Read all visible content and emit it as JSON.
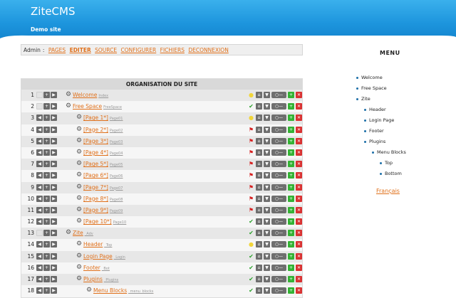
{
  "header": {
    "title": "ZiteCMS",
    "subtitle": "Demo site"
  },
  "adminbar": {
    "user": "Admin",
    "separator": ":",
    "links": [
      "PAGES",
      "EDITER",
      "SOURCE",
      "CONFIGURER",
      "FICHIERS",
      "DECONNEXION"
    ]
  },
  "panel": {
    "title": "ORGANISATION DU SITE",
    "rows": [
      {
        "num": "1",
        "label": "Welcome",
        "id": "Index",
        "level": 0,
        "status": "bulb",
        "ghost_first": true
      },
      {
        "num": "2",
        "label": "Free Space",
        "id": "FreeSpace",
        "level": 0,
        "status": "check",
        "ghost_first": true
      },
      {
        "num": "3",
        "label": "[Page 1*]",
        "id": "Page01",
        "level": 1,
        "status": "bulb",
        "ghost_first": false
      },
      {
        "num": "4",
        "label": "[Page 2*]",
        "id": "Page02",
        "level": 1,
        "status": "flag",
        "ghost_first": false
      },
      {
        "num": "5",
        "label": "[Page 3*]",
        "id": "Page03",
        "level": 1,
        "status": "flag",
        "ghost_first": false
      },
      {
        "num": "6",
        "label": "[Page 4*]",
        "id": "Page04",
        "level": 1,
        "status": "flag",
        "ghost_first": false
      },
      {
        "num": "7",
        "label": "[Page 5*]",
        "id": "Page05",
        "level": 1,
        "status": "flag",
        "ghost_first": false
      },
      {
        "num": "8",
        "label": "[Page 6*]",
        "id": "Page06",
        "level": 1,
        "status": "flag",
        "ghost_first": false
      },
      {
        "num": "9",
        "label": "[Page 7*]",
        "id": "Page07",
        "level": 1,
        "status": "flag",
        "ghost_first": false
      },
      {
        "num": "10",
        "label": "[Page 8*]",
        "id": "Page08",
        "level": 1,
        "status": "flag",
        "ghost_first": false
      },
      {
        "num": "11",
        "label": "[Page 9*]",
        "id": "Page09",
        "level": 1,
        "status": "flag",
        "ghost_first": false
      },
      {
        "num": "12",
        "label": "[Page 10*]",
        "id": "Page10",
        "level": 1,
        "status": "check",
        "ghost_first": false
      },
      {
        "num": "13",
        "label": "Zite",
        "id": "_Adv",
        "level": 0,
        "status": "check",
        "ghost_first": true
      },
      {
        "num": "14",
        "label": "Header",
        "id": "_Top",
        "level": 1,
        "status": "bulb",
        "ghost_first": false
      },
      {
        "num": "15",
        "label": "Login Page",
        "id": "_Login",
        "level": 1,
        "status": "check",
        "ghost_first": false
      },
      {
        "num": "16",
        "label": "Footer",
        "id": "_Bot",
        "level": 1,
        "status": "check",
        "ghost_first": false
      },
      {
        "num": "17",
        "label": "Plugins",
        "id": "_Plugins",
        "level": 1,
        "status": "check",
        "ghost_first": false
      },
      {
        "num": "18",
        "label": "Menu Blocks",
        "id": "_menu_blocks",
        "level": 2,
        "status": "check",
        "ghost_first": false
      }
    ]
  },
  "sidebar": {
    "title": "MENU",
    "items": [
      {
        "label": "Welcome",
        "level": 0
      },
      {
        "label": "Free Space",
        "level": 0
      },
      {
        "label": "Zite",
        "level": 0
      },
      {
        "label": "Header",
        "level": 1
      },
      {
        "label": "Login Page",
        "level": 1
      },
      {
        "label": "Footer",
        "level": 1
      },
      {
        "label": "Plugins",
        "level": 1
      },
      {
        "label": "Menu Blocks",
        "level": 2
      },
      {
        "label": "Top",
        "level": 3
      },
      {
        "label": "Bottom",
        "level": 3
      }
    ],
    "language_link": "Français"
  },
  "colors": {
    "header_blue": "#1d95dd",
    "link_orange": "#e0701a",
    "ok_green": "#34b234",
    "delete_red": "#d93232"
  }
}
